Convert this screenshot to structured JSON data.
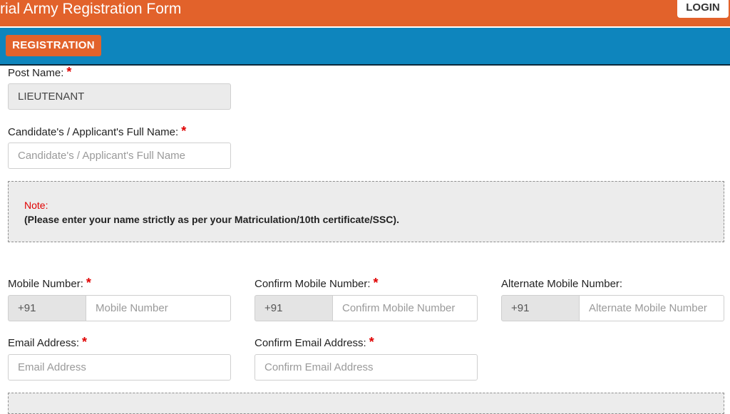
{
  "header": {
    "title": "rial Army Registration Form",
    "login_label": "LOGIN"
  },
  "nav": {
    "registration_label": "REGISTRATION"
  },
  "form": {
    "post_name": {
      "label": "Post Name:",
      "required": "*",
      "value": "LIEUTENANT"
    },
    "full_name": {
      "label": "Candidate's / Applicant's Full Name:",
      "required": "*",
      "placeholder": "Candidate's / Applicant's Full Name"
    },
    "note": {
      "title": "Note:",
      "text": "(Please enter your name strictly as per your Matriculation/10th certificate/SSC)."
    },
    "mobile": {
      "label": "Mobile Number:",
      "required": "*",
      "prefix": "+91",
      "placeholder": "Mobile Number"
    },
    "confirm_mobile": {
      "label": "Confirm Mobile Number:",
      "required": "*",
      "prefix": "+91",
      "placeholder": "Confirm Mobile Number"
    },
    "alternate_mobile": {
      "label": "Alternate Mobile Number:",
      "prefix": "+91",
      "placeholder": "Alternate Mobile Number"
    },
    "email": {
      "label": "Email Address:",
      "required": "*",
      "placeholder": "Email Address"
    },
    "confirm_email": {
      "label": "Confirm Email Address:",
      "required": "*",
      "placeholder": "Confirm Email Address"
    }
  },
  "colors": {
    "header_orange": "#e2622b",
    "nav_blue": "#0e85bd",
    "required_red": "#e00000",
    "note_background": "#ececec"
  }
}
